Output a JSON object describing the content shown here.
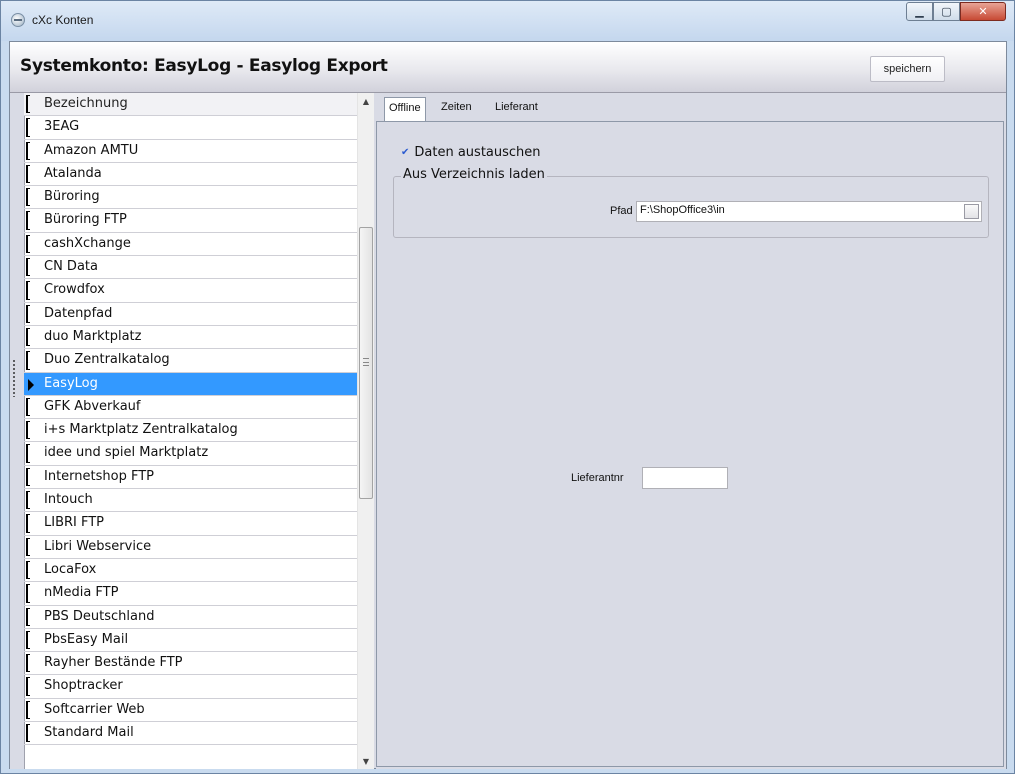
{
  "window": {
    "title": "cXc Konten"
  },
  "header": {
    "title": "Systemkonto: EasyLog - Easylog Export",
    "save_label": "speichern"
  },
  "list": {
    "column_header": "Bezeichnung",
    "selected": "EasyLog",
    "items": [
      "3EAG",
      "Amazon AMTU",
      "Atalanda",
      "Büroring",
      "Büroring FTP",
      "cashXchange",
      "CN Data",
      "Crowdfox",
      "Datenpfad",
      "duo Marktplatz",
      "Duo Zentralkatalog",
      "EasyLog",
      "GFK Abverkauf",
      "i+s Marktplatz Zentralkatalog",
      "idee und spiel Marktplatz",
      "Internetshop FTP",
      "Intouch",
      "LIBRI FTP",
      "Libri Webservice",
      "LocaFox",
      "nMedia FTP",
      "PBS Deutschland",
      "PbsEasy Mail",
      "Rayher Bestände FTP",
      "Shoptracker",
      "Softcarrier Web",
      "Standard Mail"
    ]
  },
  "tabs": [
    {
      "label": "Offline",
      "active": true
    },
    {
      "label": "Zeiten",
      "active": false
    },
    {
      "label": "Lieferant",
      "active": false
    }
  ],
  "offline": {
    "exchange_label": "Daten austauschen",
    "exchange_checked": true,
    "group_label": "Aus Verzeichnis laden",
    "path_label": "Pfad",
    "path_value": "F:\\ShopOffice3\\in",
    "supplier_label": "Lieferantnr",
    "supplier_value": ""
  }
}
